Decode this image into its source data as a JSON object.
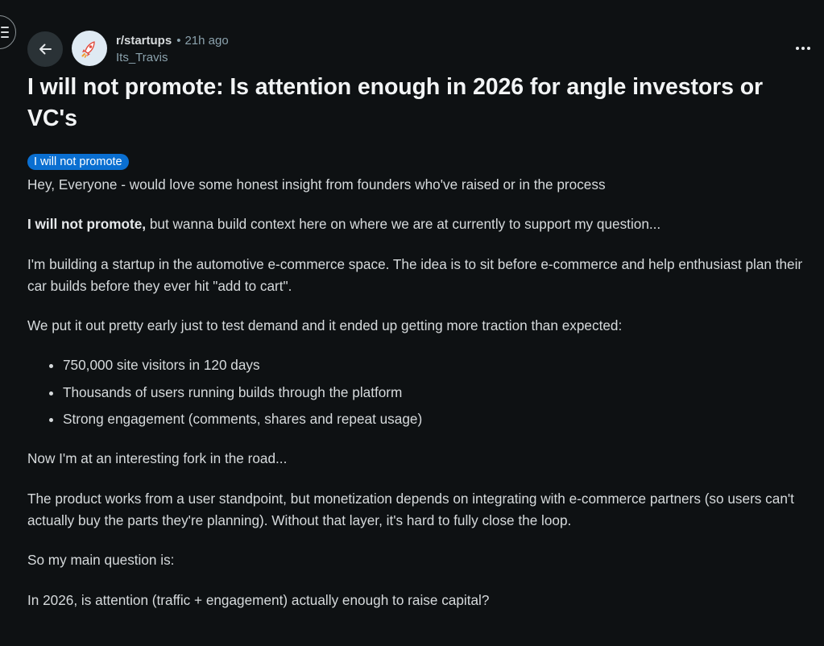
{
  "header": {
    "subreddit": "r/startups",
    "separator": "•",
    "time_ago": "21h ago",
    "author": "Its_Travis"
  },
  "post": {
    "title": "I will not promote: Is attention enough in 2026 for angle investors or VC's",
    "flair": "I will not promote",
    "intro": "Hey, Everyone - would love some honest insight from founders who've raised or in the process",
    "disclaimer_bold": "I will not promote,",
    "disclaimer_rest": " but wanna build context here on where we are at currently to support my question...",
    "description": "I'm building a startup in the automotive e-commerce space. The idea is to sit before e-commerce and help enthusiast plan their car builds before they ever hit \"add to cart\".",
    "traction_intro": "We put it out pretty early just to test demand and it ended up getting more traction than expected:",
    "traction_items": [
      "750,000 site visitors in 120 days",
      "Thousands of users running builds through the platform",
      "Strong engagement (comments, shares and repeat usage)"
    ],
    "fork": "Now I'm at an interesting fork in the road...",
    "monetization": "The product works from a user standpoint, but monetization depends on integrating with e-commerce partners (so users can't actually buy the parts they're planning). Without that layer, it's hard to fully close the loop.",
    "question_intro": "So my main question is:",
    "question": "In 2026, is attention (traffic + engagement) actually enough to raise capital?"
  },
  "icons": {
    "menu": "hamburger-menu-icon",
    "back": "arrow-left-icon",
    "avatar": "rocket-icon",
    "more": "more-horizontal-icon"
  },
  "colors": {
    "background": "#0e1113",
    "flair": "#0a6fd1",
    "muted_text": "#8ba2ad",
    "button_bg": "#2a3236"
  }
}
